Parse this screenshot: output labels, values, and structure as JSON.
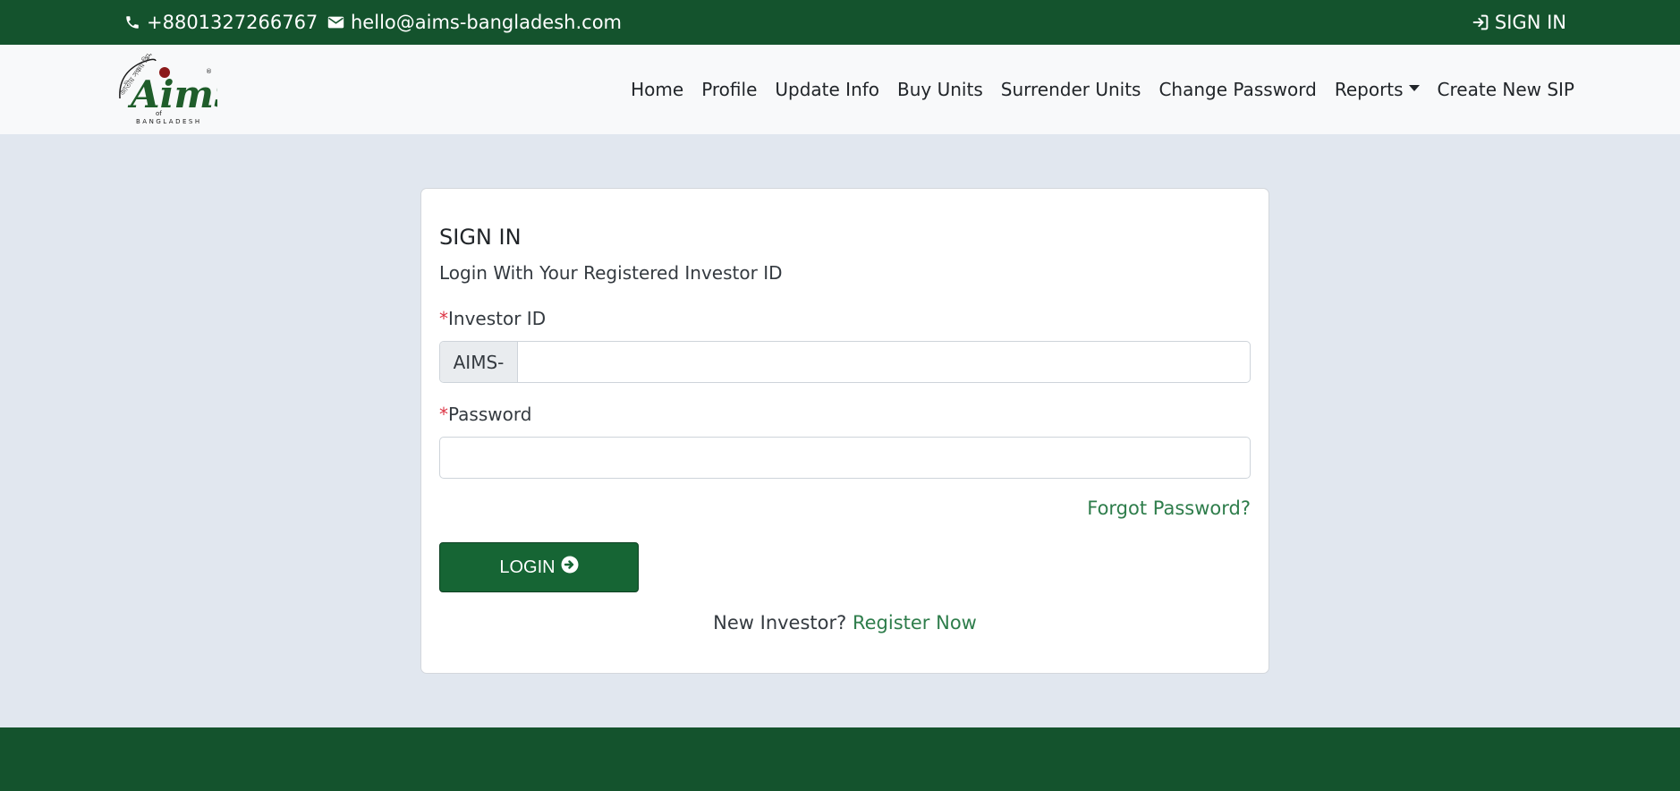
{
  "topbar": {
    "phone": "+8801327266767",
    "email": "hello@aims-bangladesh.com",
    "signin_label": "SIGN IN"
  },
  "logo": {
    "bengali_text": "জাতীয় সঞ্চয় স্কিম",
    "brand_text": "AimS",
    "of_text": "of",
    "country_text": "BANGLADESH",
    "registered_mark": "®"
  },
  "nav": {
    "items": [
      {
        "label": "Home"
      },
      {
        "label": "Profile"
      },
      {
        "label": "Update Info"
      },
      {
        "label": "Buy Units"
      },
      {
        "label": "Surrender Units"
      },
      {
        "label": "Change Password"
      },
      {
        "label": "Reports"
      },
      {
        "label": "Create New SIP"
      }
    ]
  },
  "signin_card": {
    "title": "SIGN IN",
    "subtitle": "Login With Your Registered Investor ID",
    "required_mark": "*",
    "investor_id_label": "Investor ID",
    "investor_id_prefix": "AIMS-",
    "investor_id_value": "",
    "password_label": "Password",
    "password_value": "",
    "forgot_password": "Forgot Password?",
    "login_button": "LOGIN",
    "new_investor_text": "New Investor?",
    "register_link": "Register Now"
  },
  "colors": {
    "brand_green": "#14532d",
    "button_green": "#166534",
    "link_green": "#2e7d4b",
    "page_bg": "#e1e7ef",
    "required_red": "#dc3545"
  },
  "icons": {
    "phone": "phone-icon",
    "email": "envelope-icon",
    "signin": "sign-in-icon",
    "login": "arrow-circle-right-icon",
    "dropdown": "caret-down-icon"
  }
}
